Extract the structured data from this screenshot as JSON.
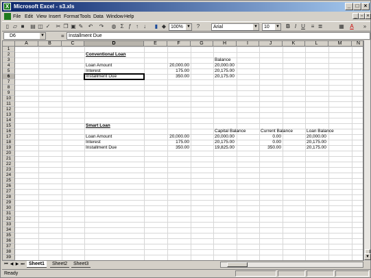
{
  "window": {
    "title": "Microsoft Excel - s3.xls"
  },
  "menu": [
    "File",
    "Edit",
    "View",
    "Insert",
    "Format",
    "Tools",
    "Data",
    "Window",
    "Help"
  ],
  "toolbar": {
    "zoom": "100%",
    "font": "Arial",
    "font_size": "10",
    "help": "?"
  },
  "formula_bar": {
    "name_box": "D6",
    "equals": "=",
    "content": "Installment Due"
  },
  "columns": [
    "A",
    "B",
    "C",
    "D",
    "E",
    "F",
    "G",
    "H",
    "I",
    "J",
    "K",
    "L",
    "M",
    "N"
  ],
  "rows": [
    "1",
    "2",
    "3",
    "4",
    "5",
    "6",
    "7",
    "8",
    "9",
    "10",
    "11",
    "12",
    "13",
    "14",
    "15",
    "16",
    "17",
    "18",
    "19",
    "20",
    "21",
    "22",
    "23",
    "24",
    "25",
    "26",
    "27",
    "28",
    "29",
    "30",
    "31",
    "32",
    "33",
    "34",
    "35",
    "36",
    "37",
    "38",
    "39"
  ],
  "cells": {
    "d2": "Conventional Loan",
    "h3": "Balance",
    "d4": "Loan Amount",
    "f4": "20,000.00",
    "h4": "20,000.00",
    "d5": "Interest",
    "f5": "175.00",
    "h5": "20,175.00",
    "d6": "Installment Due",
    "f6": "350.00",
    "h6": "20,175.00",
    "d14": "Smart Loan",
    "h15": "Capital Balance",
    "j15": "Current Balance",
    "l15": "Loan Balance",
    "d16": "Loan Amount",
    "f16": "20,000.00",
    "h16": "20,000.00",
    "j16": "0.00",
    "l16": "20,000.00",
    "d17": "Interest",
    "f17": "175.00",
    "h17": "20,175.00",
    "j17": "0.00",
    "l17": "20,175.00",
    "d18": "Installment Due",
    "f18": "350.00",
    "h18": "19,825.00",
    "j18": "350.00",
    "l18": "20,175.00"
  },
  "sheets": [
    "Sheet1",
    "Sheet2",
    "Sheet3"
  ],
  "status": "Ready"
}
